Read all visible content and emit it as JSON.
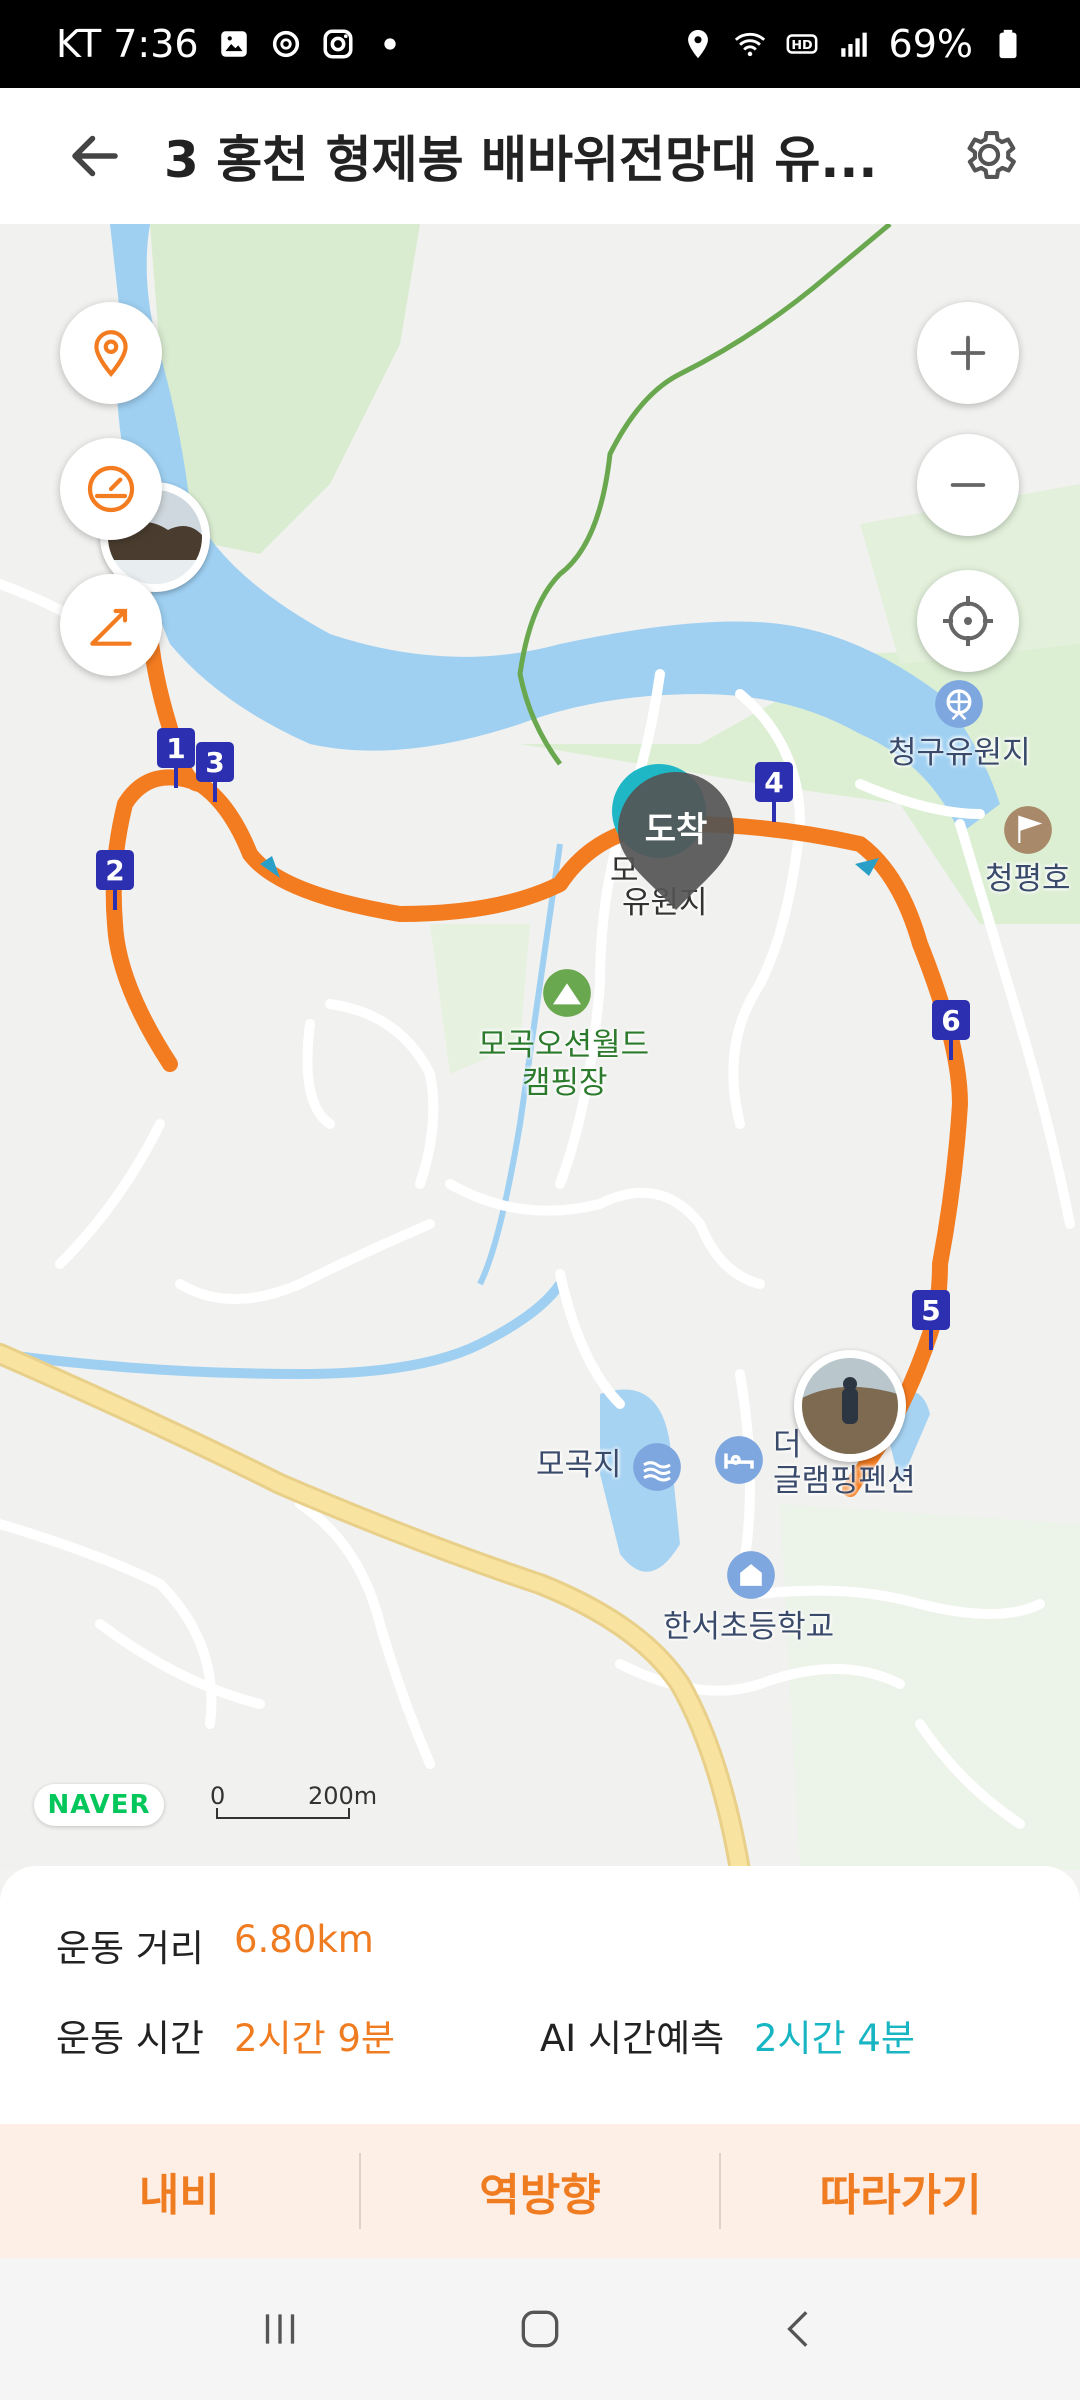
{
  "status": {
    "carrier_time": "KT 7:36",
    "battery": "69%",
    "icons": [
      "gallery-icon",
      "threads-icon",
      "instagram-icon",
      "dot-icon",
      "location-icon",
      "wifi-icon",
      "hd-icon",
      "signal-icon",
      "battery-icon"
    ]
  },
  "header": {
    "title": "3 홍천 형제봉 배바위전망대 유...",
    "back_icon": "arrow-left-icon",
    "settings_icon": "gear-icon"
  },
  "map": {
    "labels": {
      "chunggu": "청구유원지",
      "cheongpyeong": "청평호",
      "dest_partial_1": "모",
      "dest_partial_2": "유원지",
      "campground_1": "모곡오션월드",
      "campground_2": "캠핑장",
      "mogokji": "모곡지",
      "glamping_1": "더",
      "glamping_2": "글램핑펜션",
      "school": "한서초등학교"
    },
    "arrival_pin": "도착",
    "markers": [
      "1",
      "2",
      "3",
      "4",
      "5",
      "6"
    ],
    "naver": "NAVER",
    "scale_zero": "0",
    "scale_dist": "200m",
    "colors": {
      "route": "#f47c20",
      "river": "#9fd0f2",
      "green": "#d9ecd0",
      "road_main": "#f8e3a0"
    }
  },
  "info": {
    "distance_label": "운동 거리",
    "distance_value": "6.80km",
    "time_label": "운동 시간",
    "time_value": "2시간 9분",
    "ai_label": "AI 시간예측",
    "ai_value": "2시간 4분"
  },
  "actions": {
    "navi": "내비",
    "reverse": "역방향",
    "follow": "따라가기"
  }
}
